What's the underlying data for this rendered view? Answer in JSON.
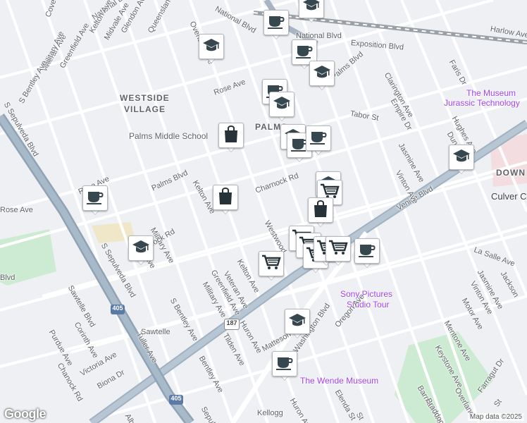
{
  "map": {
    "areas": [
      {
        "text": "WESTSIDE",
        "name": "area-westside"
      },
      {
        "text": "VILLAGE",
        "name": "area-village"
      },
      {
        "text": "PALMS",
        "name": "area-palms"
      },
      {
        "text": "DOWN",
        "name": "area-down"
      },
      {
        "text": "Culver C",
        "name": "city-culver"
      }
    ],
    "pois": [
      {
        "text": "Palms Middle School",
        "name": "poi-palms-middle"
      },
      {
        "text": "The Museum",
        "name": "poi-museum-1"
      },
      {
        "text": "Jurassic Technology",
        "name": "poi-museum-2"
      },
      {
        "text": "Sony Pictures",
        "name": "poi-sony-1"
      },
      {
        "text": "Studio Tour",
        "name": "poi-sony-2"
      },
      {
        "text": "The Wende Museum",
        "name": "poi-wende"
      }
    ],
    "streets": [
      "National Blvd",
      "National Blvd",
      "Coventry",
      "Kelton Ave",
      "Midvale Ave",
      "Glendon Ave",
      "Queensland St",
      "Overland Ave",
      "National Blvd",
      "Exposition Blvd",
      "Harlow Ave",
      "Veteran Ave",
      "Greenfield Ave",
      "Military Ave",
      "S Bentley Ave",
      "S Sepulveda Blvd",
      "Palms Blvd",
      "Rose Ave",
      "Palms Blvd",
      "Kelton Ave",
      "Rose Ave",
      "Charnock Rd",
      "Military Ave",
      "Tilden Ave",
      "S Sepulveda Blvd",
      "Chanock Rd",
      "Sawtelle Blvd",
      "Purdue Ave",
      "Corinth Ave",
      "Chanock Rd",
      "Victoria Ave",
      "Biona Dr",
      "Tuller Ave",
      "S Bentley Ave",
      "Military Ave",
      "Greenfield Ave",
      "Veteran Ave",
      "Kelton Ave",
      "Huron Ave",
      "Tilden Ave",
      "Bentley Ave",
      "Westwood",
      "Matteson",
      "Washington Blvd",
      "Oregon Ave",
      "Huron Ave",
      "Elenda St",
      "Venice Blvd",
      "Tabor St",
      "Clarington Ave",
      "Empire Dr",
      "Faris Dr",
      "Hughes Ave",
      "Dunn",
      "Jasmine Ave",
      "Vinton Ave",
      "Jasmine Ave",
      "La Salle Ave",
      "Jackson",
      "Vinton Ave",
      "Motor Ave",
      "Mentone Ave",
      "Keystone Ave",
      "Barman Ave",
      "Overland",
      "Braddock Dr",
      "Farragut Dr",
      "St",
      "Rose Ave",
      "Blvd",
      "Kellogg",
      "Albright",
      "Sepulveda",
      "Sawtelle",
      "St"
    ],
    "highway_shields": [
      "405",
      "405",
      "187"
    ],
    "logo": "Google",
    "attribution": "Map data ©2025",
    "colors": {
      "land": "#eef0f3",
      "park": "#cdebd2",
      "highway": "#8fa3b5",
      "road": "#ffffff",
      "rail": "#8a8a8a",
      "poi_purple": "#a142f4",
      "poi_green": "#0f9d58",
      "shield_blue": "#5b7aa6"
    }
  },
  "markers": [
    {
      "icon": "school-icon"
    },
    {
      "icon": "coffee-icon"
    },
    {
      "icon": "coffee-icon"
    },
    {
      "icon": "school-icon"
    },
    {
      "icon": "school-icon"
    },
    {
      "icon": "coffee-icon"
    },
    {
      "icon": "school-icon"
    },
    {
      "icon": "school-icon"
    },
    {
      "icon": "shopping-bag-icon"
    },
    {
      "icon": "coffee-icon"
    },
    {
      "icon": "coffee-icon"
    },
    {
      "icon": "shopping-bag-icon"
    },
    {
      "icon": "coffee-icon"
    },
    {
      "icon": "school-icon"
    },
    {
      "icon": "school-icon"
    },
    {
      "icon": "shopping-cart-icon"
    },
    {
      "icon": "shopping-bag-icon"
    },
    {
      "icon": "shopping-cart-icon"
    },
    {
      "icon": "shopping-cart-icon"
    },
    {
      "icon": "shopping-cart-icon"
    },
    {
      "icon": "shopping-cart-icon"
    },
    {
      "icon": "shopping-cart-icon"
    },
    {
      "icon": "coffee-icon"
    },
    {
      "icon": "school-icon"
    },
    {
      "icon": "coffee-icon"
    },
    {
      "icon": "school-icon"
    },
    {
      "icon": "shopping-cart-icon"
    }
  ]
}
